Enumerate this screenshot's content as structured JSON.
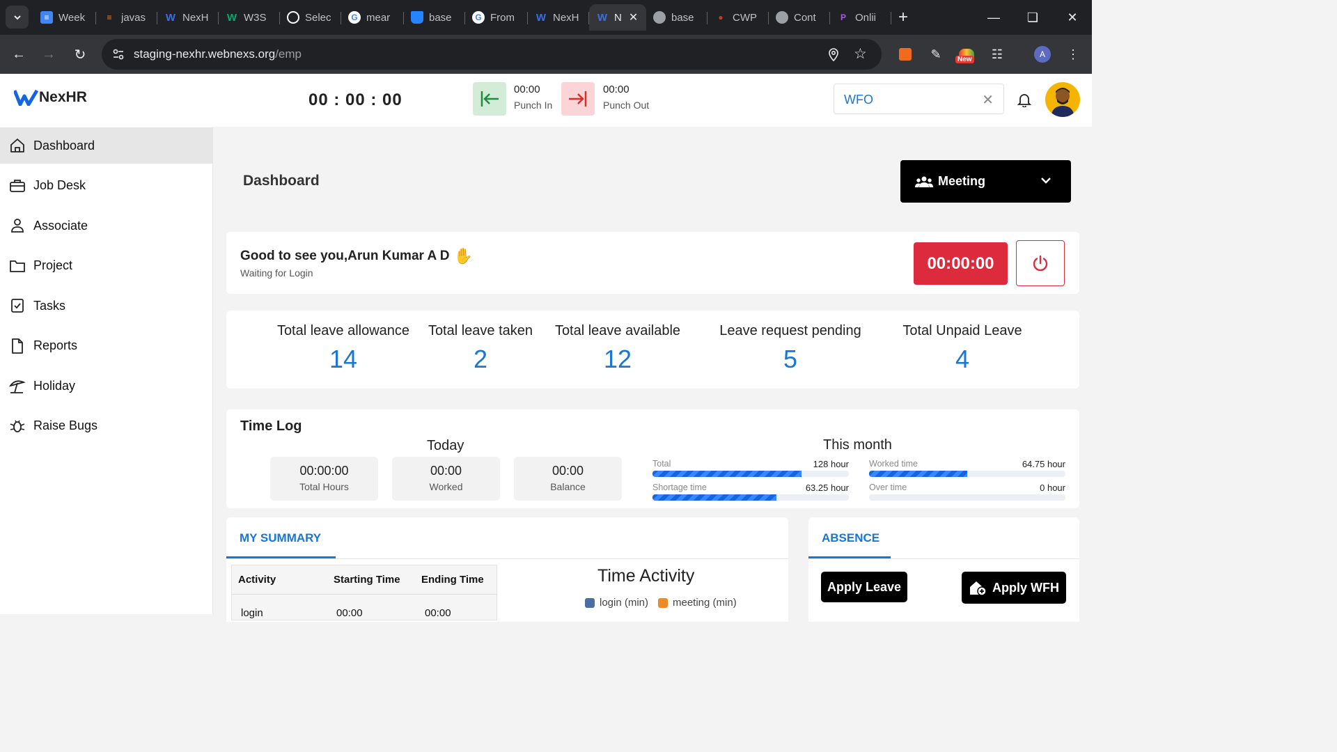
{
  "browser": {
    "tabs": [
      {
        "label": "Week",
        "icon": "docs-icon",
        "color": "#4285f4"
      },
      {
        "label": "javas",
        "icon": "stackoverflow-icon",
        "color": "#f48024"
      },
      {
        "label": "NexH",
        "icon": "nexhr-icon",
        "color": "#3b6fe0"
      },
      {
        "label": "W3S",
        "icon": "w3schools-icon",
        "color": "#04aa6d"
      },
      {
        "label": "Selec",
        "icon": "openai-icon",
        "color": "#ffffff"
      },
      {
        "label": "mear",
        "icon": "google-icon",
        "color": "#ffffff"
      },
      {
        "label": "base",
        "icon": "bitbucket-icon",
        "color": "#2684ff"
      },
      {
        "label": "From",
        "icon": "google-icon",
        "color": "#ffffff"
      },
      {
        "label": "NexH",
        "icon": "nexhr-icon",
        "color": "#3b6fe0"
      },
      {
        "label": "N",
        "icon": "nexhr-icon",
        "color": "#3b6fe0",
        "active": true
      },
      {
        "label": "base",
        "icon": "globe-icon",
        "color": "#9aa0a6"
      },
      {
        "label": "CWP",
        "icon": "cwp-icon",
        "color": "#c0392b"
      },
      {
        "label": "Cont",
        "icon": "globe-icon",
        "color": "#9aa0a6"
      },
      {
        "label": "Onlii",
        "icon": "online-icon",
        "color": "#a855f7"
      }
    ],
    "url_host": "staging-nexhr.webnexs.org",
    "url_path": "/emp",
    "profile_initial": "A",
    "ext_badge": "New"
  },
  "header": {
    "brand": "NexHR",
    "timer": "00 : 00 : 00",
    "punch_in_time": "00:00",
    "punch_in_label": "Punch In",
    "punch_out_time": "00:00",
    "punch_out_label": "Punch Out",
    "work_mode": "WFO"
  },
  "sidebar": {
    "items": [
      {
        "label": "Dashboard",
        "icon": "home-icon",
        "active": true
      },
      {
        "label": "Job Desk",
        "icon": "briefcase-icon"
      },
      {
        "label": "Associate",
        "icon": "person-icon"
      },
      {
        "label": "Project",
        "icon": "folder-icon"
      },
      {
        "label": "Tasks",
        "icon": "checklist-icon"
      },
      {
        "label": "Reports",
        "icon": "document-icon"
      },
      {
        "label": "Holiday",
        "icon": "beach-umbrella-icon"
      },
      {
        "label": "Raise Bugs",
        "icon": "bug-icon"
      }
    ]
  },
  "main": {
    "title": "Dashboard",
    "meeting_label": "Meeting",
    "greeting": "Good to see you,Arun Kumar A D",
    "greeting_sub": "Waiting for Login",
    "login_timer": "00:00:00",
    "stats": [
      {
        "label": "Total leave allowance",
        "value": "14"
      },
      {
        "label": "Total leave taken",
        "value": "2"
      },
      {
        "label": "Total leave available",
        "value": "12"
      },
      {
        "label": "Leave request pending",
        "value": "5"
      },
      {
        "label": "Total Unpaid Leave",
        "value": "4"
      }
    ],
    "timelog": {
      "title": "Time Log",
      "today_label": "Today",
      "month_label": "This month",
      "today": [
        {
          "value": "00:00:00",
          "label": "Total Hours"
        },
        {
          "value": "00:00",
          "label": "Worked"
        },
        {
          "value": "00:00",
          "label": "Balance"
        }
      ],
      "month": [
        {
          "label": "Total",
          "value": "128 hour",
          "fill": 0.76
        },
        {
          "label": "Worked time",
          "value": "64.75 hour",
          "fill": 0.5
        },
        {
          "label": "Shortage time",
          "value": "63.25 hour",
          "fill": 0.63
        },
        {
          "label": "Over time",
          "value": "0 hour",
          "fill": 0
        }
      ]
    },
    "summary": {
      "tab": "MY SUMMARY",
      "columns": [
        "Activity",
        "Starting Time",
        "Ending Time"
      ],
      "rows": [
        [
          "login",
          "00:00",
          "00:00"
        ]
      ],
      "chart_title": "Time Activity",
      "legend": [
        {
          "label": "login (min)",
          "color": "#4a6fa5"
        },
        {
          "label": "meeting (min)",
          "color": "#f08a24"
        }
      ]
    },
    "absence": {
      "tab": "ABSENCE",
      "apply_leave": "Apply Leave",
      "apply_wfh": "Apply WFH"
    }
  },
  "colors": {
    "accent": "#1976d2",
    "danger": "#dc2b3c",
    "punch_in_bg": "#d3ecd8",
    "punch_out_bg": "#fbd4d8"
  }
}
